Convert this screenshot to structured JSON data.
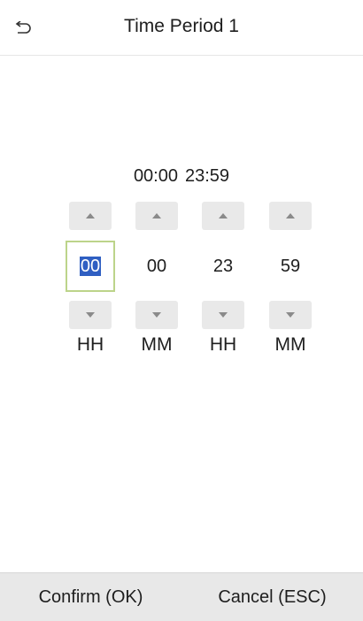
{
  "header": {
    "title": "Time Period 1",
    "back_icon": "back-arrow-icon"
  },
  "range": {
    "start": "00:00",
    "end": "23:59"
  },
  "fields": [
    {
      "value": "00",
      "unit": "HH",
      "focused": true
    },
    {
      "value": "00",
      "unit": "MM",
      "focused": false
    },
    {
      "value": "23",
      "unit": "HH",
      "focused": false
    },
    {
      "value": "59",
      "unit": "MM",
      "focused": false
    }
  ],
  "footer": {
    "confirm_label": "Confirm (OK)",
    "cancel_label": "Cancel (ESC)"
  },
  "colors": {
    "selection": "#2f5fc2",
    "focus_border": "#bcd48a",
    "footer_bg": "#e8e8e8",
    "arrow_btn_bg": "#e9e9e9"
  }
}
